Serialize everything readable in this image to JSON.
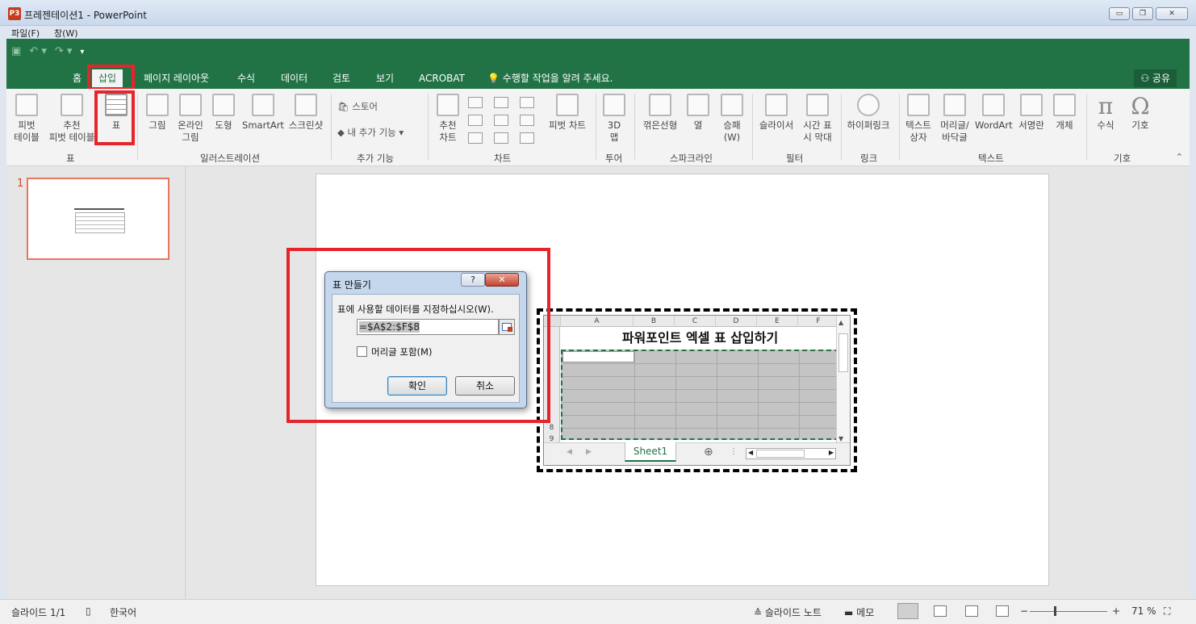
{
  "window": {
    "title": "프레젠테이션1 - PowerPoint",
    "app_badge": "P3"
  },
  "menubar": {
    "file": "파일(F)",
    "window": "창(W)"
  },
  "ribbon": {
    "tabs": [
      "홈",
      "삽입",
      "페이지 레이아웃",
      "수식",
      "데이터",
      "검토",
      "보기",
      "ACROBAT",
      "수행할 작업을 알려 주세요."
    ],
    "active_tab": "삽입",
    "share": "공유",
    "groups": {
      "table": {
        "label": "표",
        "pivot": "피벗\n테이블",
        "rec_pivot": "추천\n피벗 테이블",
        "table": "표"
      },
      "illustrations": {
        "label": "일러스트레이션",
        "picture": "그림",
        "online_picture": "온라인\n그림",
        "shapes": "도형",
        "smartart": "SmartArt",
        "screenshot": "스크린샷"
      },
      "addins": {
        "label": "추가 기능",
        "store": "스토어",
        "my_addins": "내 추가 기능"
      },
      "charts": {
        "label": "차트",
        "rec_chart": "추천\n차트",
        "pivot_chart": "피벗 차트"
      },
      "tours": {
        "label": "투어",
        "map": "3D\n맵"
      },
      "sparklines": {
        "label": "스파크라인",
        "line": "꺾은선형",
        "column": "열",
        "winloss": "승패\n(W)"
      },
      "filters": {
        "label": "필터",
        "slicer": "슬라이서",
        "timeline": "시간 표\n시 막대"
      },
      "links": {
        "label": "링크",
        "hyperlink": "하이퍼링크"
      },
      "text": {
        "label": "텍스트",
        "textbox": "텍스트\n상자",
        "header_footer": "머리글/\n바닥글",
        "wordart": "WordArt",
        "signature": "서명란",
        "object": "개체"
      },
      "symbols": {
        "label": "기호",
        "equation": "수식",
        "symbol": "기호"
      }
    }
  },
  "slides_panel": {
    "slide_number": "1"
  },
  "excel_object": {
    "columns": [
      "A",
      "B",
      "C",
      "D",
      "E",
      "F"
    ],
    "rows": [
      "8",
      "9"
    ],
    "title": "파워포인트 엑셀 표 삽입하기",
    "sheet_tab": "Sheet1"
  },
  "dialog": {
    "title": "표 만들기",
    "help": "?",
    "close": "✕",
    "prompt": "표에 사용할 데이터를 지정하십시오(W).",
    "range_value": "=$A$2:$F$8",
    "header_checkbox": "머리글 포함(M)",
    "header_checked": false,
    "ok": "확인",
    "cancel": "취소"
  },
  "statusbar": {
    "slide_info": "슬라이드 1/1",
    "language": "한국어",
    "notes": "슬라이드 노트",
    "comments": "메모",
    "zoom": "71 %"
  }
}
